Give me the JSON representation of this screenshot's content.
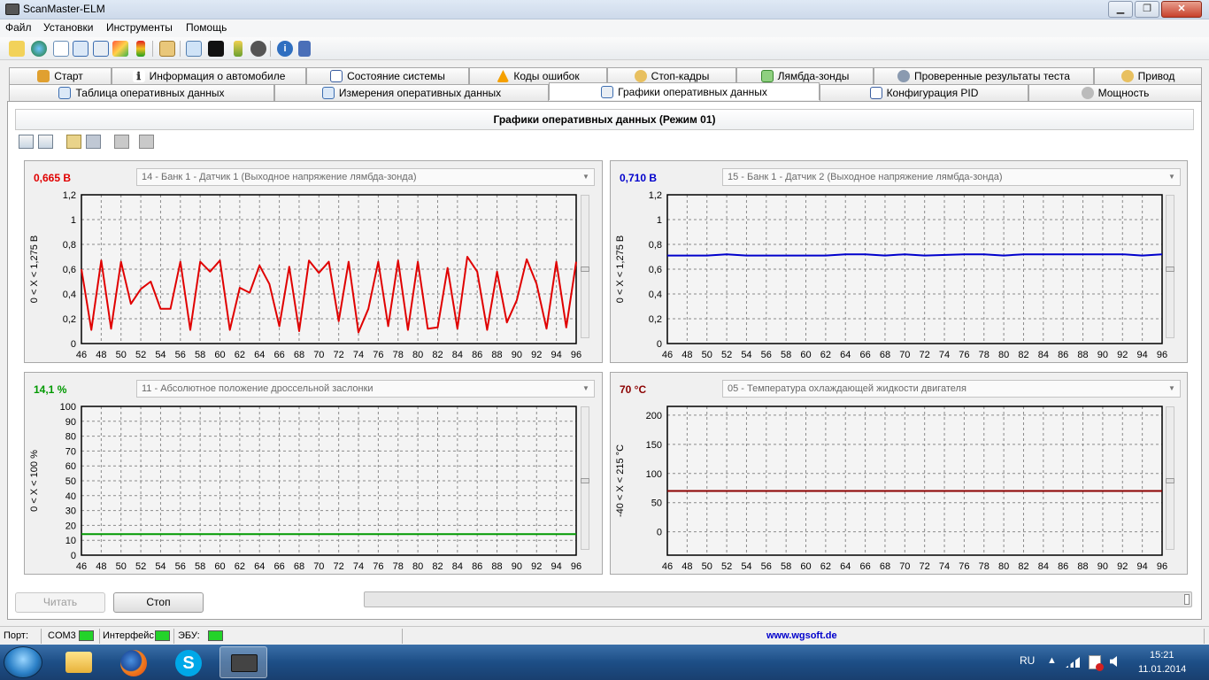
{
  "window": {
    "title": "ScanMaster-ELM",
    "buttons": {
      "minimize": "▁",
      "maximize": "❐",
      "close": "✕"
    }
  },
  "menu": [
    "Файл",
    "Установки",
    "Инструменты",
    "Помощь"
  ],
  "toolbar_icons": [
    "wizard-icon",
    "globe-icon",
    "document-icon",
    "table-icon",
    "chart-icon",
    "chart-color-icon",
    "traffic-light-icon",
    "clipboard-icon",
    "search-icon",
    "terminal-icon",
    "battery-icon",
    "stop-icon",
    "info-icon",
    "book-icon"
  ],
  "tabs_row1": [
    {
      "label": "Старт",
      "icon": "start-icon"
    },
    {
      "label": "Информация о автомобиле",
      "icon": "info-icon"
    },
    {
      "label": "Состояние системы",
      "icon": "checklist-icon"
    },
    {
      "label": "Коды ошибок",
      "icon": "warning-icon"
    },
    {
      "label": "Стоп-кадры",
      "icon": "hand-icon"
    },
    {
      "label": "Лямбда-зонды",
      "icon": "lambda-icon"
    },
    {
      "label": "Проверенные результаты теста",
      "icon": "gear-icon"
    },
    {
      "label": "Привод",
      "icon": "drive-icon"
    }
  ],
  "tabs_row2": [
    {
      "label": "Таблица оперативных данных",
      "icon": "table-icon"
    },
    {
      "label": "Измерения оперативных данных",
      "icon": "grid-icon"
    },
    {
      "label": "Графики оперативных данных",
      "icon": "chart-icon",
      "active": true
    },
    {
      "label": "Конфигурация PID",
      "icon": "config-icon"
    },
    {
      "label": "Мощность",
      "icon": "power-icon"
    }
  ],
  "main": {
    "heading": "Графики оперативных данных (Режим 01)"
  },
  "colors": {
    "red": "#e00000",
    "blue": "#0000cc",
    "green": "#009900",
    "darkred": "#8b0000",
    "grid": "#8a8a8a"
  },
  "charts": [
    {
      "value": "0,665 В",
      "value_color": "#e00000",
      "pid": "14 - Банк 1 - Датчик 1 (Выходное напряжение лямбда-зонда)",
      "ylabel": "0   < X <   1,275  В"
    },
    {
      "value": "0,710 В",
      "value_color": "#0000cc",
      "pid": "15 - Банк 1 - Датчик 2 (Выходное напряжение лямбда-зонда)",
      "ylabel": "0   < X <   1,275  В"
    },
    {
      "value": "14,1 %",
      "value_color": "#009900",
      "pid": "11 - Абсолютное положение дроссельной заслонки",
      "ylabel": "0   < X <   100  %"
    },
    {
      "value": "70 °C",
      "value_color": "#8b0000",
      "pid": "05 - Температура охлаждающей жидкости двигателя",
      "ylabel": "-40  < X <   215  °C"
    }
  ],
  "chart_data": [
    {
      "type": "line",
      "title": "14 - Банк 1 - Датчик 1 (Выходное напряжение лямбда-зонда)",
      "ylabel": "0 < X < 1,275 В",
      "xlim": [
        46,
        96
      ],
      "ylim": [
        0,
        1.2
      ],
      "xticks": [
        46,
        48,
        50,
        52,
        54,
        56,
        58,
        60,
        62,
        64,
        66,
        68,
        70,
        72,
        74,
        76,
        78,
        80,
        82,
        84,
        86,
        88,
        90,
        92,
        94,
        96
      ],
      "yticks": [
        0,
        0.2,
        0.4,
        0.6,
        0.8,
        1,
        1.2
      ],
      "ytick_labels": [
        "0",
        "0,2",
        "0,4",
        "0,6",
        "0,8",
        "1",
        "1,2"
      ],
      "grid": true,
      "color": "#e00000",
      "series": [
        {
          "x": [
            46,
            47,
            48,
            49,
            50,
            51,
            52,
            53,
            54,
            55,
            56,
            57,
            58,
            59,
            60,
            61,
            62,
            63,
            64,
            65,
            66,
            67,
            68,
            69,
            70,
            71,
            72,
            73,
            74,
            75,
            76,
            77,
            78,
            79,
            80,
            81,
            82,
            83,
            84,
            85,
            86,
            87,
            88,
            89,
            90,
            91,
            92,
            93,
            94,
            95,
            96
          ],
          "y": [
            0.6,
            0.11,
            0.67,
            0.12,
            0.66,
            0.32,
            0.44,
            0.5,
            0.28,
            0.28,
            0.66,
            0.11,
            0.66,
            0.58,
            0.67,
            0.11,
            0.45,
            0.41,
            0.63,
            0.48,
            0.14,
            0.62,
            0.1,
            0.67,
            0.57,
            0.66,
            0.18,
            0.66,
            0.09,
            0.28,
            0.66,
            0.14,
            0.67,
            0.11,
            0.66,
            0.12,
            0.13,
            0.61,
            0.12,
            0.7,
            0.58,
            0.11,
            0.58,
            0.17,
            0.35,
            0.68,
            0.48,
            0.12,
            0.66,
            0.13,
            0.66
          ]
        }
      ]
    },
    {
      "type": "line",
      "title": "15 - Банк 1 - Датчик 2 (Выходное напряжение лямбда-зонда)",
      "ylabel": "0 < X < 1,275 В",
      "xlim": [
        46,
        96
      ],
      "ylim": [
        0,
        1.2
      ],
      "xticks": [
        46,
        48,
        50,
        52,
        54,
        56,
        58,
        60,
        62,
        64,
        66,
        68,
        70,
        72,
        74,
        76,
        78,
        80,
        82,
        84,
        86,
        88,
        90,
        92,
        94,
        96
      ],
      "yticks": [
        0,
        0.2,
        0.4,
        0.6,
        0.8,
        1,
        1.2
      ],
      "ytick_labels": [
        "0",
        "0,2",
        "0,4",
        "0,6",
        "0,8",
        "1",
        "1,2"
      ],
      "grid": true,
      "color": "#0000cc",
      "series": [
        {
          "x": [
            46,
            50,
            52,
            54,
            58,
            62,
            64,
            66,
            68,
            70,
            72,
            76,
            78,
            80,
            82,
            86,
            90,
            92,
            94,
            96
          ],
          "y": [
            0.71,
            0.71,
            0.72,
            0.71,
            0.71,
            0.71,
            0.72,
            0.72,
            0.71,
            0.72,
            0.71,
            0.72,
            0.72,
            0.71,
            0.72,
            0.72,
            0.72,
            0.72,
            0.71,
            0.72
          ]
        }
      ]
    },
    {
      "type": "line",
      "title": "11 - Абсолютное положение дроссельной заслонки",
      "ylabel": "0 < X < 100 %",
      "xlim": [
        46,
        96
      ],
      "ylim": [
        0,
        100
      ],
      "xticks": [
        46,
        48,
        50,
        52,
        54,
        56,
        58,
        60,
        62,
        64,
        66,
        68,
        70,
        72,
        74,
        76,
        78,
        80,
        82,
        84,
        86,
        88,
        90,
        92,
        94,
        96
      ],
      "yticks": [
        0,
        10,
        20,
        30,
        40,
        50,
        60,
        70,
        80,
        90,
        100
      ],
      "ytick_labels": [
        "0",
        "10",
        "20",
        "30",
        "40",
        "50",
        "60",
        "70",
        "80",
        "90",
        "100"
      ],
      "grid": true,
      "color": "#009900",
      "series": [
        {
          "x": [
            46,
            96
          ],
          "y": [
            14.1,
            14.1
          ]
        }
      ]
    },
    {
      "type": "line",
      "title": "05 - Температура охлаждающей жидкости двигателя",
      "ylabel": "-40 < X < 215 °C",
      "xlim": [
        46,
        96
      ],
      "ylim": [
        -40,
        215
      ],
      "xticks": [
        46,
        48,
        50,
        52,
        54,
        56,
        58,
        60,
        62,
        64,
        66,
        68,
        70,
        72,
        74,
        76,
        78,
        80,
        82,
        84,
        86,
        88,
        90,
        92,
        94,
        96
      ],
      "yticks": [
        0,
        50,
        100,
        150,
        200
      ],
      "ytick_labels": [
        "0",
        "50",
        "100",
        "150",
        "200"
      ],
      "grid": true,
      "color": "#8b0000",
      "series": [
        {
          "x": [
            46,
            96
          ],
          "y": [
            70,
            70
          ]
        }
      ]
    }
  ],
  "buttons": {
    "read": "Читать",
    "stop": "Стоп"
  },
  "status": {
    "port_label": "Порт:",
    "port_value": "COM3",
    "interface_label": "Интерфейс:",
    "ecu_label": "ЭБУ:",
    "url": "www.wgsoft.de"
  },
  "taskbar": {
    "lang": "RU",
    "time": "15:21",
    "date": "11.01.2014",
    "apps": [
      "explorer-icon",
      "firefox-icon",
      "skype-icon",
      "scanmaster-icon"
    ]
  }
}
